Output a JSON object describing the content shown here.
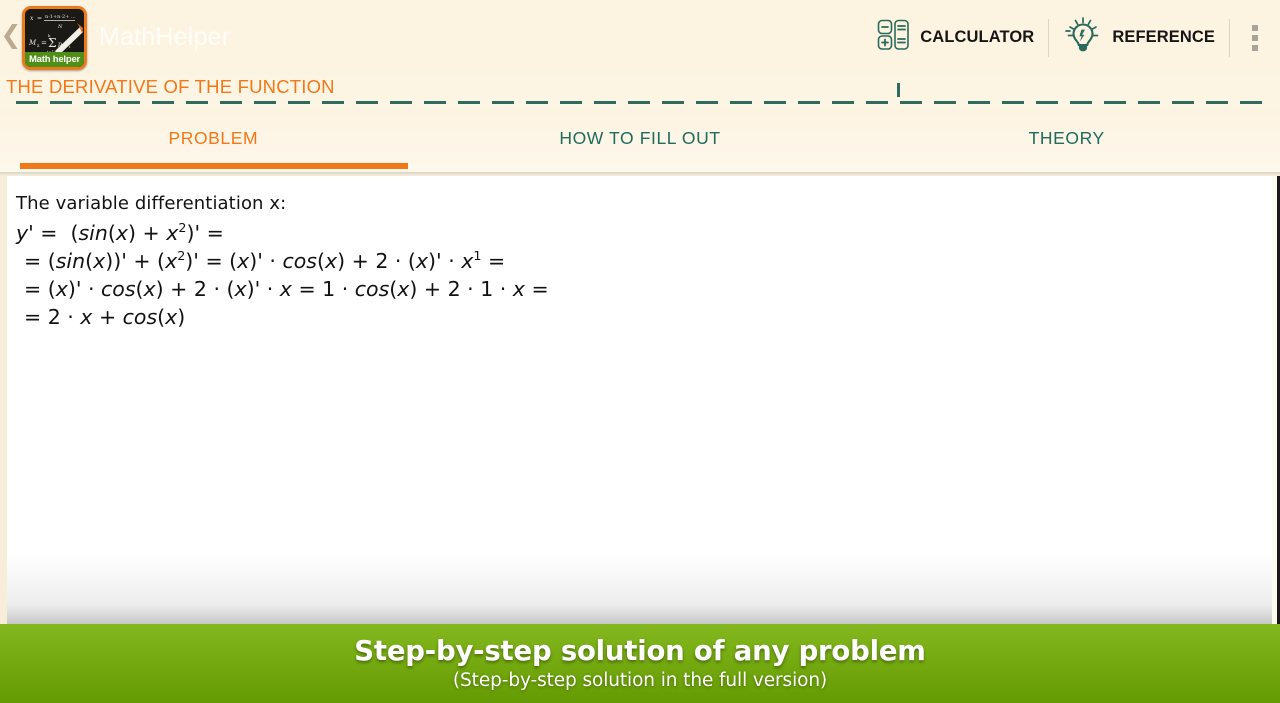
{
  "app": {
    "name": "MathHelper",
    "logo_tag": "Math helper",
    "back_icon": "chevron-left-icon",
    "overflow_icon": "overflow-menu-icon"
  },
  "header": {
    "actions": [
      {
        "label": "CALCULATOR",
        "icon": "calculator-icon"
      },
      {
        "label": "REFERENCE",
        "icon": "lightbulb-icon"
      }
    ]
  },
  "subtitle": "THE DERIVATIVE OF THE FUNCTION",
  "tabs": [
    {
      "label": "PROBLEM",
      "active": true
    },
    {
      "label": "HOW TO FILL OUT",
      "active": false
    },
    {
      "label": "THEORY",
      "active": false
    }
  ],
  "content": {
    "intro": "The variable differentiation x:",
    "lines": [
      "y' =  (sin(x) + x²)' =",
      "= (sin(x))' + (x²)' = (x)' · cos(x) + 2 · (x)' · x¹ =",
      "= (x)' · cos(x) + 2 · (x)' · x = 1 · cos(x) + 2 · 1 · x =",
      "= 2 · x + cos(x)"
    ]
  },
  "banner": {
    "title": "Step-by-step solution of any problem",
    "subtitle": "(Step-by-step solution in the full version)"
  },
  "colors": {
    "accent_orange": "#f07818",
    "teal": "#1f6b5c",
    "banner_green": "#76ac12",
    "cream": "#fdf3e1"
  }
}
